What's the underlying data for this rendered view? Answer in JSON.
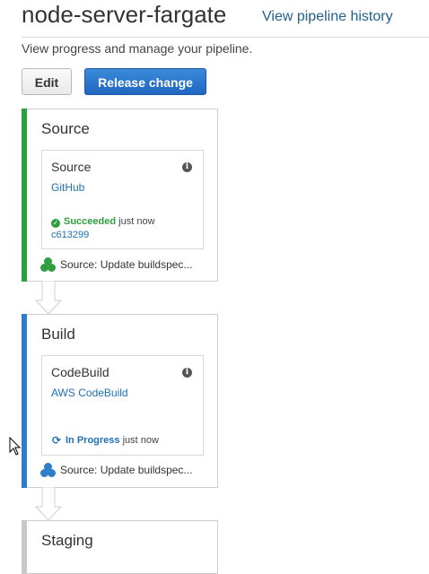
{
  "header": {
    "title": "node-server-fargate",
    "history_link": "View pipeline history",
    "subtitle": "View progress and manage your pipeline."
  },
  "toolbar": {
    "edit_label": "Edit",
    "release_label": "Release change"
  },
  "colors": {
    "succeeded": "#2e9e3e",
    "in_progress": "#2f7cc7",
    "pending": "#c8c8c8",
    "link": "#1f6fb5"
  },
  "stages": [
    {
      "name": "Source",
      "action": {
        "name": "Source",
        "provider": "GitHub",
        "status": "Succeeded",
        "time": "just now",
        "commit": "c613299"
      },
      "footer": "Source: Update buildspec..."
    },
    {
      "name": "Build",
      "action": {
        "name": "CodeBuild",
        "provider": "AWS CodeBuild",
        "status": "In Progress",
        "time": "just now"
      },
      "footer": "Source: Update buildspec..."
    },
    {
      "name": "Staging"
    }
  ]
}
